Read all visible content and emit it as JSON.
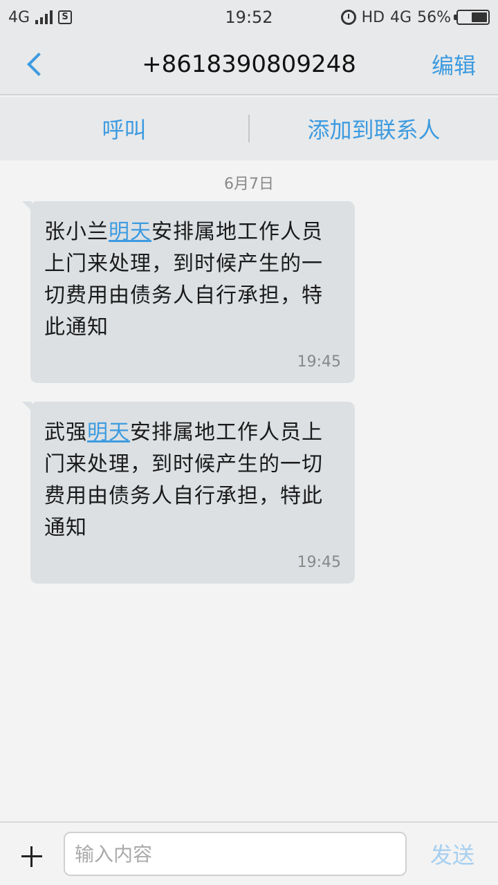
{
  "status_bar": {
    "network": "4G",
    "time": "19:52",
    "hd": "HD",
    "network2": "4G",
    "battery_pct": "56%",
    "battery_level": 0.56
  },
  "header": {
    "title": "+8618390809248",
    "edit_label": "编辑"
  },
  "actions": {
    "call_label": "呼叫",
    "add_contact_label": "添加到联系人"
  },
  "date_label": "6月7日",
  "messages": [
    {
      "pre": "张小兰",
      "link": "明天",
      "post": "安排属地工作人员上门来处理，到时候产生的一切费用由债务人自行承担，特此通知",
      "time": "19:45"
    },
    {
      "pre": "武强",
      "link": "明天",
      "post": "安排属地工作人员上门来处理，到时候产生的一切费用由债务人自行承担，特此通知",
      "time": "19:45"
    }
  ],
  "input": {
    "placeholder": "输入内容",
    "send_label": "发送"
  }
}
